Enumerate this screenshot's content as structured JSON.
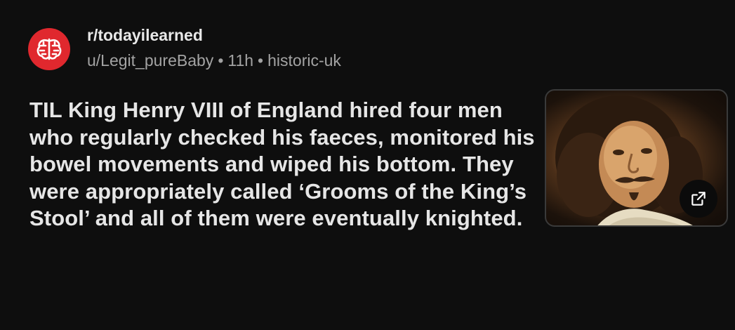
{
  "post": {
    "subreddit": "r/todayilearned",
    "author": "u/Legit_pureBaby",
    "age": "11h",
    "flair": "historic-uk",
    "separator": "•",
    "title": "TIL King Henry VIII of England hired four men who regularly checked his faeces, monitored his bowel movements and wiped his bottom. They were appropriately called ‘Grooms of the King’s Stool’ and all of them were eventually knighted."
  },
  "icons": {
    "avatar": "brain-icon",
    "external_link": "external-link-icon"
  },
  "colors": {
    "background": "#0e0e0e",
    "avatar_bg": "#e0282e",
    "meta_text": "#a3a3a3"
  }
}
